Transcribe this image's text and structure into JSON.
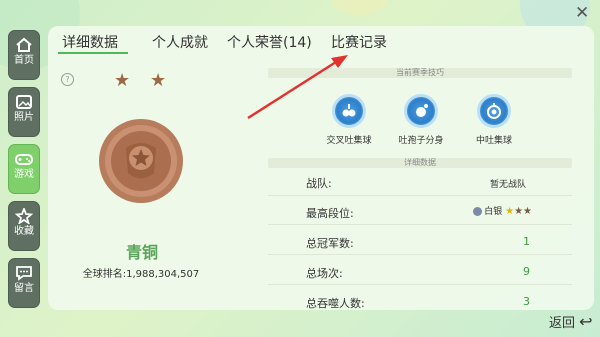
{
  "sidebar": {
    "items": [
      {
        "label": "首页",
        "icon": "home-icon"
      },
      {
        "label": "照片",
        "icon": "photo-icon"
      },
      {
        "label": "游戏",
        "icon": "gamepad-icon"
      },
      {
        "label": "收藏",
        "icon": "star-badge-icon"
      },
      {
        "label": "留言",
        "icon": "message-icon"
      }
    ],
    "active_index": 2
  },
  "tabs": [
    {
      "label": "详细数据"
    },
    {
      "label": "个人成就"
    },
    {
      "label": "个人荣誉(14)"
    },
    {
      "label": "比赛记录"
    }
  ],
  "active_tab": 0,
  "rank_card": {
    "help_icon": "question-icon",
    "rank_name": "青铜",
    "global_rank": "全球排名:1,988,304,507",
    "stars_filled": 2,
    "medal_color": "#b77c5c"
  },
  "skills_section": {
    "title": "当前赛季技巧",
    "skills": [
      {
        "name": "交叉吐集球",
        "icon": "cross-spit-icon"
      },
      {
        "name": "吐孢子分身",
        "icon": "spore-split-icon"
      },
      {
        "name": "中吐集球",
        "icon": "center-spit-icon"
      }
    ]
  },
  "details_section": {
    "title": "详细数据",
    "rows": [
      {
        "key": "战队:",
        "value": "暂无战队"
      },
      {
        "key": "最高段位:",
        "value": "白银"
      },
      {
        "key": "总冠军数:",
        "value": "1"
      },
      {
        "key": "总场次:",
        "value": "9"
      },
      {
        "key": "总吞噬人数:",
        "value": "3"
      }
    ],
    "highest_rank_stars": 3,
    "highest_rank_stars_filled": 1
  },
  "colors": {
    "accent": "#4fb858",
    "arrow": "#e53030",
    "sidebar_active": "#7fcf6a"
  },
  "close_icon": "close-icon",
  "back_label": "返回",
  "back_icon": "back-arrow-icon"
}
